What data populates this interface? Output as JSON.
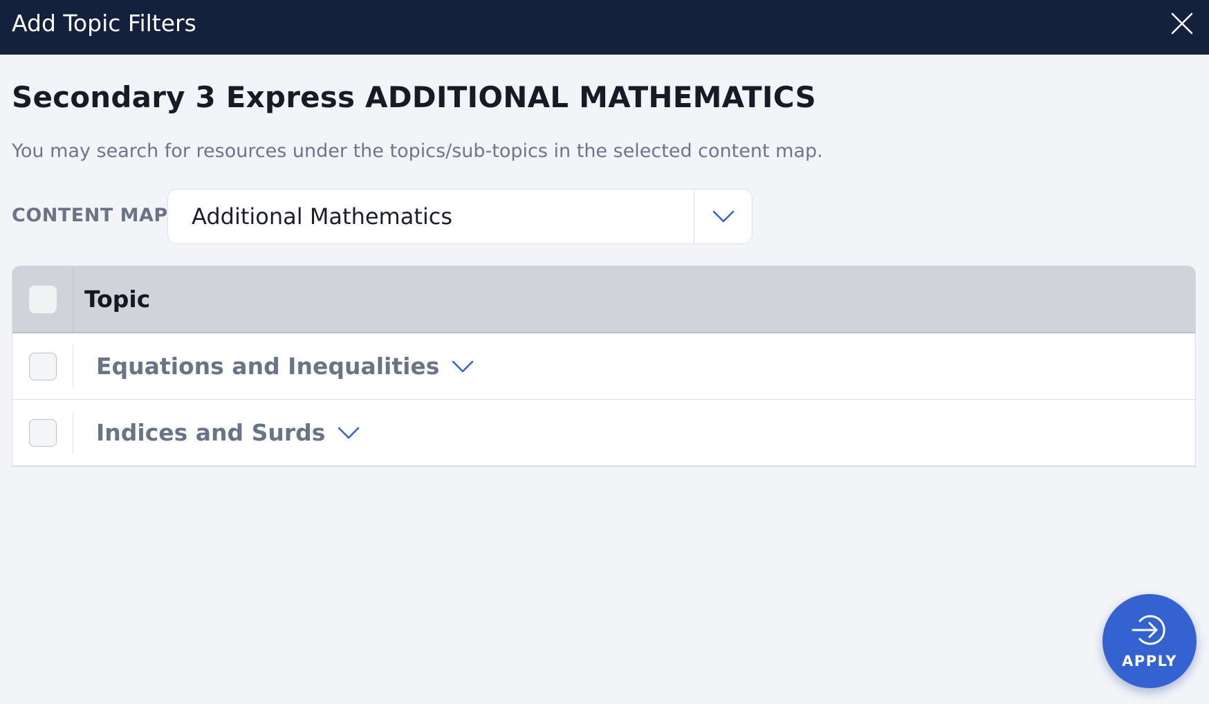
{
  "header": {
    "title": "Add Topic Filters",
    "close_icon": "close-icon"
  },
  "heading": "Secondary 3 Express ADDITIONAL MATHEMATICS",
  "description": "You may search for resources under the topics/sub-topics in the selected content map.",
  "content_map": {
    "label": "CONTENT MAP",
    "selected": "Additional Mathematics"
  },
  "table": {
    "header": "Topic",
    "rows": [
      {
        "label": "Equations and Inequalities",
        "checked": false
      },
      {
        "label": "Indices and Surds",
        "checked": false
      }
    ]
  },
  "apply_button": {
    "label": "APPLY",
    "icon": "arrow-right-circle-icon"
  },
  "colors": {
    "header_bg": "#13213c",
    "accent": "#3462d0",
    "page_bg": "#f2f4f8"
  }
}
